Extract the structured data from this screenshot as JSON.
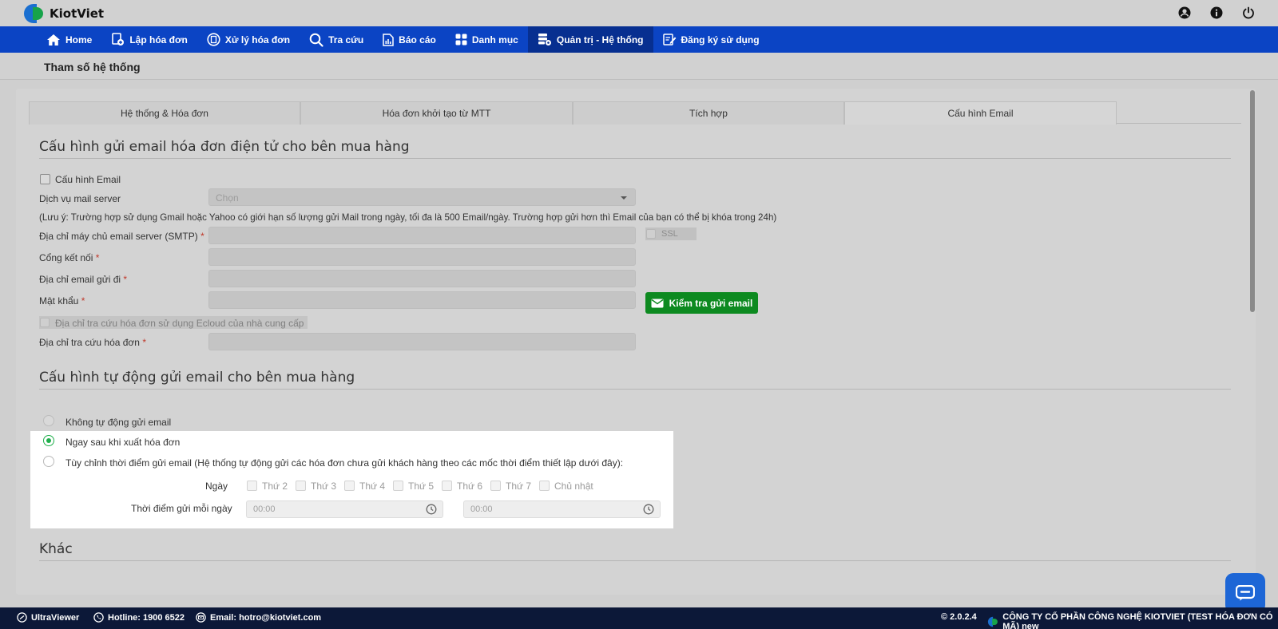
{
  "brand": {
    "name": "KiotViet"
  },
  "nav": {
    "items": [
      {
        "label": "Home",
        "icon": "home-icon"
      },
      {
        "label": "Lập hóa đơn",
        "icon": "add-invoice-icon"
      },
      {
        "label": "Xử lý hóa đơn",
        "icon": "process-invoice-icon"
      },
      {
        "label": "Tra cứu",
        "icon": "search-icon"
      },
      {
        "label": "Báo cáo",
        "icon": "report-icon"
      },
      {
        "label": "Danh mục",
        "icon": "category-icon"
      },
      {
        "label": "Quản trị - Hệ thống",
        "icon": "admin-icon"
      },
      {
        "label": "Đăng ký sử dụng",
        "icon": "register-icon"
      }
    ],
    "active_index": 6
  },
  "page": {
    "title": "Tham số hệ thống"
  },
  "tabs": [
    {
      "label": "Hệ thống & Hóa đơn"
    },
    {
      "label": "Hóa đơn khởi tạo từ MTT"
    },
    {
      "label": "Tích hợp"
    },
    {
      "label": "Cấu hình Email"
    }
  ],
  "email_config": {
    "section_title": "Cấu hình gửi email hóa đơn điện tử cho bên mua hàng",
    "enable_label": "Cấu hình Email",
    "mail_service_label": "Dịch vụ mail server",
    "mail_service_placeholder": "Chọn",
    "note": "(Lưu ý: Trường hợp sử dụng Gmail hoặc Yahoo có giới hạn số lượng gửi Mail trong ngày, tối đa là 500 Email/ngày. Trường hợp gửi hơn thì Email của bạn có thể bị khóa trong 24h)",
    "smtp_label": "Địa chỉ máy chủ email server (SMTP)",
    "ssl_label": "SSL",
    "port_label": "Cổng kết nối",
    "sender_label": "Địa chỉ email gửi đi",
    "password_label": "Mật khẩu",
    "test_button": "Kiểm tra gửi email",
    "ecloud_label": "Địa chỉ tra cứu hóa đơn sử dụng Ecloud của nhà cung cấp",
    "lookup_label": "Địa chỉ tra cứu hóa đơn",
    "required_mark": "*"
  },
  "auto_send": {
    "section_title": "Cấu hình tự động gửi email cho bên mua hàng",
    "options": [
      {
        "label": "Không tự động gửi email",
        "checked": false
      },
      {
        "label": "Ngay sau khi xuất hóa đơn",
        "checked": true
      },
      {
        "label": "Tùy chỉnh thời điểm gửi email (Hệ thống tự động gửi các hóa đơn chưa gửi khách hàng theo các mốc thời điểm thiết lập dưới đây):",
        "checked": false
      }
    ],
    "days_label": "Ngày",
    "days": [
      "Thứ 2",
      "Thứ 3",
      "Thứ 4",
      "Thứ 5",
      "Thứ 6",
      "Thứ 7",
      "Chủ nhật"
    ],
    "time_label": "Thời điểm gửi mỗi ngày",
    "time_placeholder_1": "00:00",
    "time_placeholder_2": "00:00"
  },
  "other": {
    "section_title": "Khác"
  },
  "footer": {
    "ultraviewer": "UltraViewer",
    "hotline": "Hotline: 1900 6522",
    "email": "Email: hotro@kiotviet.com",
    "version": "© 2.0.2.4",
    "company": "CÔNG TY CỔ PHẦN CÔNG NGHỆ KIOTVIET (TEST HÓA ĐƠN CÓ MÃ) new"
  },
  "colors": {
    "nav_bg": "#0b44c4",
    "nav_active": "#072f90",
    "primary_green": "#0d8a20",
    "radio_green": "#1fae4b",
    "footer_bg": "#0c1838"
  }
}
